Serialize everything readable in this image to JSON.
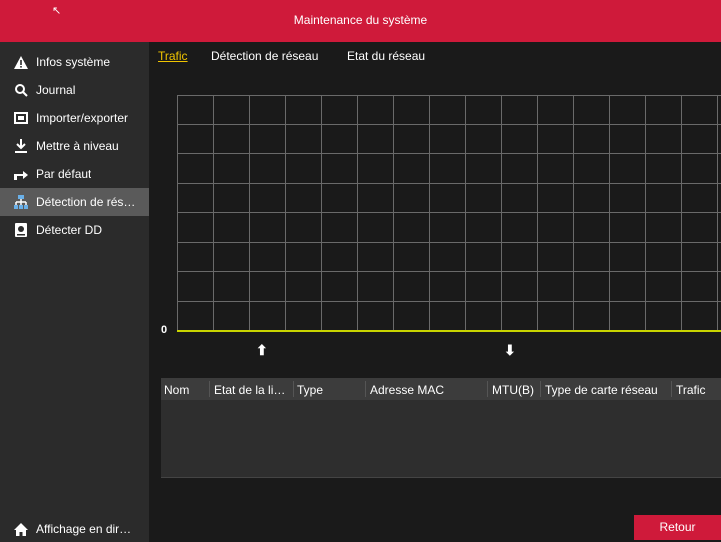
{
  "window": {
    "title": "Maintenance du système"
  },
  "sidebar": {
    "items": [
      {
        "label": "Infos système",
        "icon": "warning-icon"
      },
      {
        "label": "Journal",
        "icon": "search-icon"
      },
      {
        "label": "Importer/exporter",
        "icon": "import-export-icon"
      },
      {
        "label": "Mettre à niveau",
        "icon": "download-icon"
      },
      {
        "label": "Par défaut",
        "icon": "restore-icon"
      },
      {
        "label": "Détection de rés…",
        "icon": "network-icon",
        "active": true
      },
      {
        "label": "Détecter DD",
        "icon": "disk-icon"
      }
    ],
    "bottom": {
      "label": "Affichage en dir…",
      "icon": "home-icon"
    }
  },
  "tabs": [
    {
      "label": "Trafic",
      "active": true
    },
    {
      "label": "Détection de réseau"
    },
    {
      "label": "Etat du réseau"
    }
  ],
  "chart": {
    "y_zero_label": "0",
    "line_color": "#c8d400",
    "grid_color": "#6a6a6a"
  },
  "table": {
    "columns": [
      "Nom",
      "Etat de la li…",
      "Type",
      "Adresse MAC",
      "MTU(B)",
      "Type de carte réseau",
      "Trafic"
    ],
    "rows": []
  },
  "buttons": {
    "retour": "Retour"
  },
  "colors": {
    "accent": "#cf1a3a",
    "active_tab": "#f0c400"
  }
}
